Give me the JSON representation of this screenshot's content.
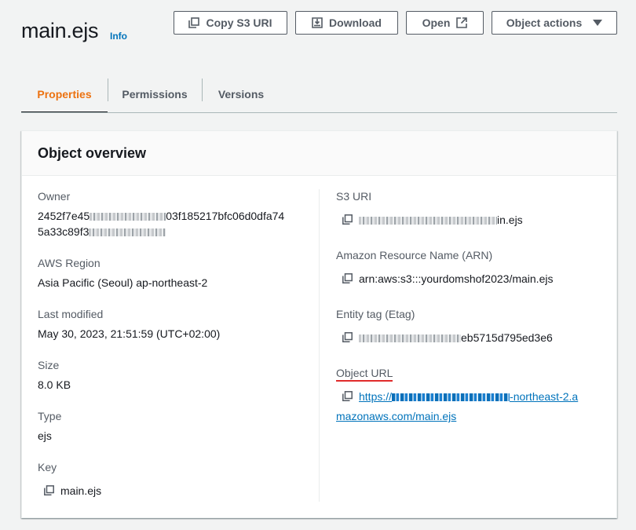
{
  "header": {
    "title": "main.ejs",
    "info": "Info"
  },
  "actions": {
    "copy_s3_uri": "Copy S3 URI",
    "download": "Download",
    "open": "Open",
    "object_actions": "Object actions"
  },
  "tabs": [
    {
      "label": "Properties",
      "active": true
    },
    {
      "label": "Permissions",
      "active": false
    },
    {
      "label": "Versions",
      "active": false
    }
  ],
  "overview": {
    "title": "Object overview",
    "owner": {
      "label": "Owner",
      "line1_start": "2452f7e45",
      "line1_end": "03f185217bfc06d0dfa74",
      "line2_start": "5a33c89f3"
    },
    "region": {
      "label": "AWS Region",
      "value": "Asia Pacific (Seoul) ap-northeast-2"
    },
    "last_modified": {
      "label": "Last modified",
      "value": "May 30, 2023, 21:51:59 (UTC+02:00)"
    },
    "size": {
      "label": "Size",
      "value": "8.0 KB"
    },
    "type": {
      "label": "Type",
      "value": "ejs"
    },
    "key": {
      "label": "Key",
      "value": "main.ejs"
    },
    "s3_uri": {
      "label": "S3 URI",
      "value_end": "in.ejs"
    },
    "arn": {
      "label": "Amazon Resource Name (ARN)",
      "value": "arn:aws:s3:::yourdomshof2023/main.ejs"
    },
    "etag": {
      "label": "Entity tag (Etag)",
      "value_end": "eb5715d795ed3e6"
    },
    "object_url": {
      "label": "Object URL",
      "line1_start": "https://",
      "line1_end": "-northeast-2.a",
      "line2": "mazonaws.com/main.ejs"
    }
  },
  "colors": {
    "accent": "#ec7211",
    "link": "#0073bb",
    "annotation_underline": "#e02b2b"
  },
  "icons": [
    "copy-icon",
    "download-icon",
    "external-link-icon",
    "caret-down-icon"
  ]
}
